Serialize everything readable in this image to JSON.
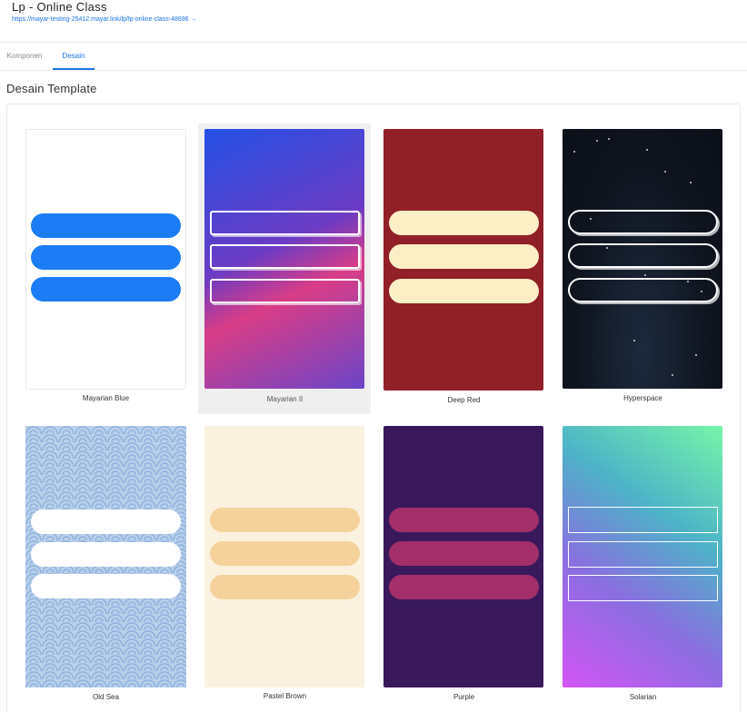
{
  "header": {
    "title": "Lp - Online Class",
    "url": "https://mayar-testing-25412.mayar.link/lp/lp-online-class-48696 →"
  },
  "tabs": [
    {
      "label": "Komponen",
      "active": false
    },
    {
      "label": "Desain",
      "active": true
    }
  ],
  "section": {
    "title": "Desain Template"
  },
  "templates": [
    {
      "name": "Mayarian Blue",
      "selected": false
    },
    {
      "name": "Mayarian II",
      "selected": true
    },
    {
      "name": "Deep Red",
      "selected": false
    },
    {
      "name": "Hyperspace",
      "selected": false
    },
    {
      "name": "Old Sea",
      "selected": false
    },
    {
      "name": "Pastel Brown",
      "selected": false
    },
    {
      "name": "Purple",
      "selected": false
    },
    {
      "name": "Solarian",
      "selected": false
    }
  ],
  "colors": {
    "accent": "#1a73e8",
    "mayarian_blue_button": "#1b7cf5",
    "deep_red_bg": "#911f27",
    "deep_red_button": "#fcefc6",
    "pastel_bg": "#faf2de",
    "pastel_button": "#f5d29c",
    "purple_bg": "#3a185c",
    "purple_button": "#a22f69"
  }
}
